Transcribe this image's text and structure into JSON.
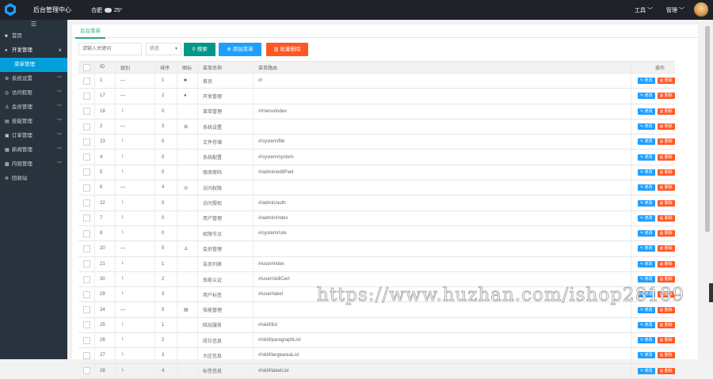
{
  "topbar": {
    "title": "后台管理中心",
    "city": "合肥",
    "temperature": "25°",
    "tools_label": "工具 ﹀",
    "manage_label": "管理 ﹀"
  },
  "sidebar": {
    "items": [
      {
        "label": "首页",
        "icon": "■",
        "caret": ""
      },
      {
        "label": "开发管理",
        "icon": "●",
        "caret": "∧"
      },
      {
        "label": "系统设置",
        "icon": "⚙",
        "caret": "﹀"
      },
      {
        "label": "访问权限",
        "icon": "◎",
        "caret": "﹀"
      },
      {
        "label": "会员管理",
        "icon": "♙",
        "caret": "﹀"
      },
      {
        "label": "技能管理",
        "icon": "▤",
        "caret": "﹀"
      },
      {
        "label": "订单管理",
        "icon": "▣",
        "caret": "﹀"
      },
      {
        "label": "新闻管理",
        "icon": "▦",
        "caret": "﹀"
      },
      {
        "label": "内容管理",
        "icon": "▩",
        "caret": "﹀"
      },
      {
        "label": "回收站",
        "icon": "⊗",
        "caret": ""
      }
    ],
    "sub_active": "菜单管理"
  },
  "tab": {
    "label": "后台菜单"
  },
  "toolbar": {
    "search_placeholder": "请输入关键词",
    "status_placeholder": "状态",
    "search_btn": "搜索",
    "add_btn": "添加菜单",
    "batch_del_btn": "批量删除"
  },
  "table": {
    "headers": {
      "id": "ID",
      "level": "级别",
      "sort": "排序",
      "icon": "图标",
      "name": "菜单名称",
      "route": "菜单路由",
      "ops": "操作"
    },
    "edit_label": "修改",
    "del_label": "删除",
    "rows": [
      {
        "id": "1",
        "level": "—",
        "sort": "1",
        "icon": "■",
        "name": "首页",
        "route": "#/"
      },
      {
        "id": "17",
        "level": "—",
        "sort": "2",
        "icon": "●",
        "name": "开发管理",
        "route": ""
      },
      {
        "id": "18",
        "level": "└",
        "sort": "0",
        "icon": "",
        "name": "菜单管理",
        "route": "#/menu/index"
      },
      {
        "id": "2",
        "level": "—",
        "sort": "3",
        "icon": "⚙",
        "name": "系统设置",
        "route": ""
      },
      {
        "id": "23",
        "level": "└",
        "sort": "0",
        "icon": "",
        "name": "文件存储",
        "route": "#/system/file"
      },
      {
        "id": "4",
        "level": "└",
        "sort": "0",
        "icon": "",
        "name": "系统配置",
        "route": "#/system/system"
      },
      {
        "id": "5",
        "level": "└",
        "sort": "0",
        "icon": "",
        "name": "修改密码",
        "route": "#/admin/editPwd"
      },
      {
        "id": "6",
        "level": "—",
        "sort": "4",
        "icon": "◎",
        "name": "访问权限",
        "route": ""
      },
      {
        "id": "22",
        "level": "└",
        "sort": "0",
        "icon": "",
        "name": "访问授权",
        "route": "#/admin/auth"
      },
      {
        "id": "7",
        "level": "└",
        "sort": "0",
        "icon": "",
        "name": "用户管理",
        "route": "#/admin/index"
      },
      {
        "id": "8",
        "level": "└",
        "sort": "0",
        "icon": "",
        "name": "权限节点",
        "route": "#/system/rule"
      },
      {
        "id": "20",
        "level": "—",
        "sort": "5",
        "icon": "♙",
        "name": "会员管理",
        "route": ""
      },
      {
        "id": "21",
        "level": "└",
        "sort": "1",
        "icon": "",
        "name": "会员列表",
        "route": "#/user/index"
      },
      {
        "id": "30",
        "level": "└",
        "sort": "2",
        "icon": "",
        "name": "技能认证",
        "route": "#/user/skillCert"
      },
      {
        "id": "29",
        "level": "└",
        "sort": "3",
        "icon": "",
        "name": "用户标签",
        "route": "#/user/label"
      },
      {
        "id": "24",
        "level": "—",
        "sort": "5",
        "icon": "▤",
        "name": "技能管理",
        "route": ""
      },
      {
        "id": "25",
        "level": "└",
        "sort": "1",
        "icon": "",
        "name": "陪玩服务",
        "route": "#/skill/list"
      },
      {
        "id": "26",
        "level": "└",
        "sort": "2",
        "icon": "",
        "name": "段位信息",
        "route": "#/skill/paragraphList"
      },
      {
        "id": "27",
        "level": "└",
        "sort": "3",
        "icon": "",
        "name": "大区信息",
        "route": "#/skill/largeareaList"
      },
      {
        "id": "28",
        "level": "└",
        "sort": "4",
        "icon": "",
        "name": "标签信息",
        "route": "#/skill/labelList"
      }
    ]
  },
  "watermark": "https://www.huzhan.com/ishop28189"
}
